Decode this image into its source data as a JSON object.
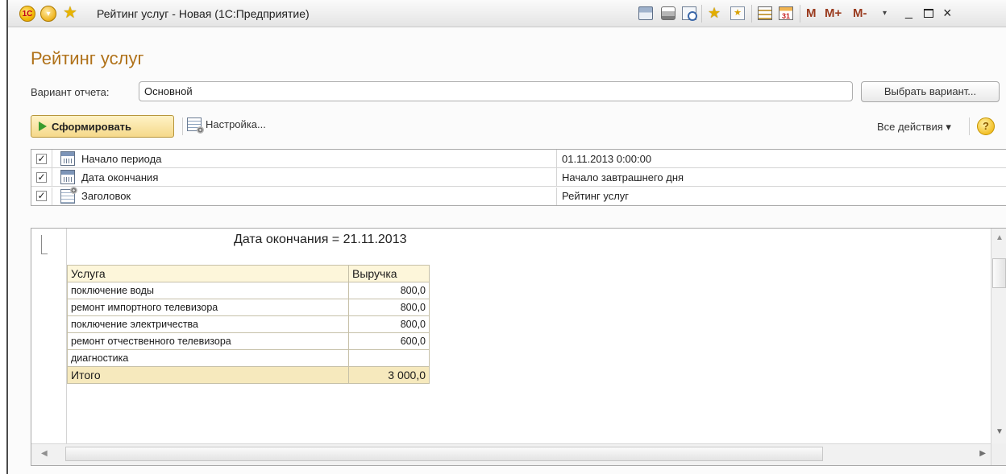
{
  "window": {
    "title": "Рейтинг услуг - Новая  (1С:Предприятие)",
    "logo_text": "1С",
    "m_buttons": [
      "M",
      "M+",
      "M-"
    ],
    "minimize_glyph": "_",
    "close_glyph": "×"
  },
  "form": {
    "title": "Рейтинг услуг",
    "variant_label": "Вариант отчета:",
    "variant_value": "Основной",
    "choose_variant_label": "Выбрать вариант..."
  },
  "toolbar": {
    "generate_label": "Сформировать",
    "settings_label": "Настройка...",
    "all_actions_label": "Все действия ▾",
    "help_label": "?"
  },
  "settings": [
    {
      "checked": true,
      "icon": "calendar-icon",
      "name": "Начало периода",
      "value": "01.11.2013 0:00:00"
    },
    {
      "checked": true,
      "icon": "calendar-icon",
      "name": "Дата окончания",
      "value": "Начало завтрашнего дня"
    },
    {
      "checked": true,
      "icon": "settings-doc-icon",
      "name": "Заголовок",
      "value": "Рейтинг услуг"
    }
  ],
  "report": {
    "heading": "Дата окончания = 21.11.2013",
    "columns": [
      "Услуга",
      "Выручка"
    ],
    "rows": [
      {
        "service": "поключение воды",
        "revenue": "800,0"
      },
      {
        "service": "ремонт импортного телевизора",
        "revenue": "800,0"
      },
      {
        "service": "поключение электричества",
        "revenue": "800,0"
      },
      {
        "service": "ремонт отчественного телевизора",
        "revenue": "600,0"
      },
      {
        "service": "диагностика",
        "revenue": ""
      }
    ],
    "total_label": "Итого",
    "total_value": "3 000,0"
  },
  "colors": {
    "title_accent": "#b0721a",
    "generate_button": "#f5d98a",
    "table_header": "#fdf6da",
    "table_total": "#f6e9bd"
  }
}
